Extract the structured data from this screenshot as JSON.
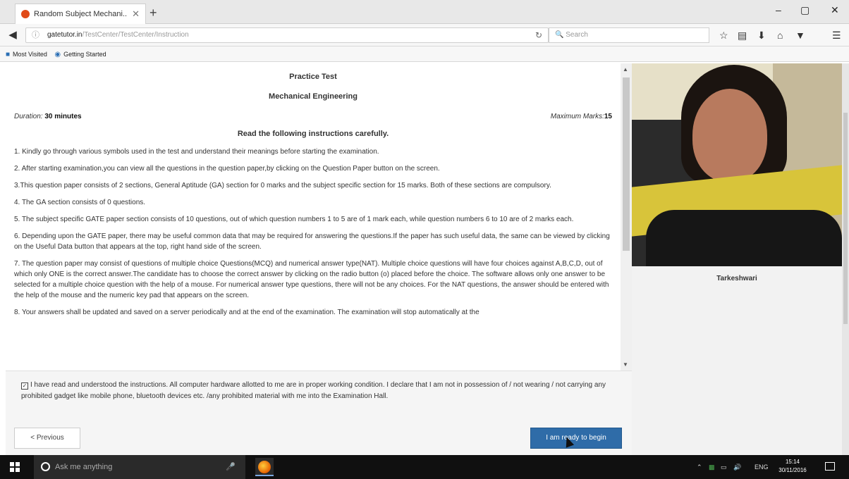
{
  "browser": {
    "tab_title": "Random Subject Mechani...",
    "tab_close": "✕",
    "new_tab": "+",
    "win_min": "–",
    "win_max": "▢",
    "win_close": "✕",
    "url_host": "gatetutor.in",
    "url_path": "/TestCenter/TestCenter/Instruction",
    "search_placeholder": "Search",
    "bookmarks": [
      "Most Visited",
      "Getting Started"
    ]
  },
  "test": {
    "title": "Practice Test",
    "subject": "Mechanical Engineering",
    "duration_label": "Duration:",
    "duration_value": "30 minutes",
    "max_marks_label": "Maximum Marks:",
    "max_marks_value": "15",
    "heading": "Read the following instructions carefully.",
    "instructions": [
      "1. Kindly go through various symbols used in the test and understand their meanings before starting the examination.",
      "2. After starting examination,you can view all the questions in the question paper,by clicking on the Question Paper button on the screen.",
      "3.This question paper consists of 2 sections, General Aptitude (GA) section for 0 marks and the subject specific section for 15 marks. Both of these sections are compulsory.",
      "4. The GA section consists of 0 questions.",
      "5. The subject specific GATE paper section consists of 10 questions, out of which question numbers 1 to 5 are of 1 mark each, while question numbers 6 to 10 are of 2 marks each.",
      "6. Depending upon the GATE paper, there may be useful common data that may be required for answering the questions.If the paper has such useful data, the same can be viewed by clicking on the Useful Data button that appears at the top, right hand side of the screen.",
      "7. The question paper may consist of questions of multiple choice Questions(MCQ) and numerical answer type(NAT). Multiple choice questions will have four choices against A,B,C,D, out of which only ONE is the correct answer.The candidate has to choose the correct answer by clicking on the radio button (o) placed before the choice. The software allows only one answer to be selected for a multiple choice question with the help of a mouse. For numerical answer type questions, there will not be any choices. For the NAT questions, the answer should be entered with the help of the mouse and the numeric key pad that appears on the screen.",
      "8. Your answers shall be updated and saved on a server periodically and at the end of the examination. The examination will stop automatically at the"
    ],
    "declaration": "I have read and understood the instructions. All computer hardware allotted to me are in proper working condition. I declare that I am not in possession of / not wearing / not carrying any prohibited gadget like mobile phone, bluetooth devices etc. /any prohibited material with me into the Examination Hall.",
    "declaration_checked": true,
    "prev_button": "< Previous",
    "begin_button": "I am ready to begin"
  },
  "candidate": {
    "name": "Tarkeshwari"
  },
  "taskbar": {
    "search_placeholder": "Ask me anything",
    "lang": "ENG",
    "time": "15:14",
    "date": "30/11/2016"
  },
  "colors": {
    "primary_button": "#2f6ca8",
    "taskbar": "#101010"
  }
}
